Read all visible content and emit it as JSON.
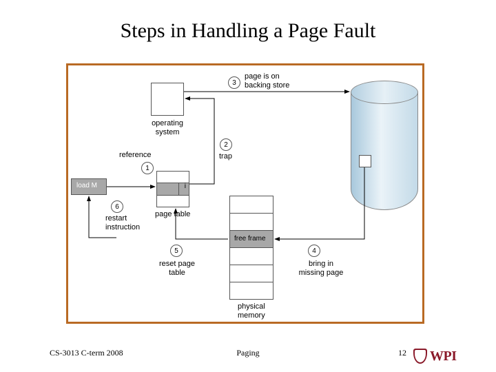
{
  "title": "Steps in Handling a Page Fault",
  "footer": {
    "course": "CS-3013 C-term 2008",
    "topic": "Paging",
    "page": "12",
    "institution": "WPI"
  },
  "diagram": {
    "labels": {
      "page_on_backing_store": "page is on\nbacking store",
      "operating_system": "operating\nsystem",
      "reference": "reference",
      "trap": "trap",
      "load_m": "load M",
      "page_table": "page table",
      "restart_instruction": "restart\ninstruction",
      "reset_page_table": "reset page\ntable",
      "free_frame": "free frame",
      "bring_in_missing_page": "bring in\nmissing page",
      "physical_memory": "physical\nmemory",
      "invalid_bit": "i"
    },
    "steps": {
      "s1": "1",
      "s2": "2",
      "s3": "3",
      "s4": "4",
      "s5": "5",
      "s6": "6"
    }
  }
}
